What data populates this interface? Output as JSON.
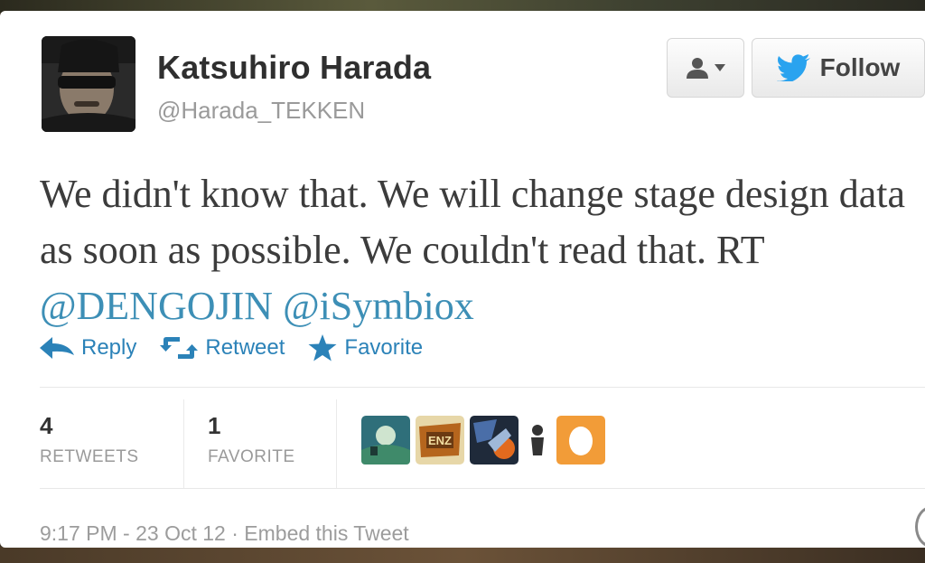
{
  "user": {
    "name": "Katsuhiro Harada",
    "handle": "@Harada_TEKKEN"
  },
  "buttons": {
    "follow_label": "Follow"
  },
  "tweet": {
    "text": "We didn't know that. We will change stage design data as soon as possible. We couldn't read that. RT ",
    "mention1": "@DENGOJIN",
    "mention2": "@iSymbiox"
  },
  "actions": {
    "reply": "Reply",
    "retweet": "Retweet",
    "favorite": "Favorite"
  },
  "stats": {
    "retweets_count": "4",
    "retweets_label": "RETWEETS",
    "favorites_count": "1",
    "favorites_label": "FAVORITE"
  },
  "footer": {
    "timestamp": "9:17 PM - 23 Oct 12",
    "separator": " · ",
    "embed": "Embed this Tweet"
  },
  "colors": {
    "link": "#2b82b8",
    "mention": "#3d8fb6",
    "twitter_bird": "#2aa3ef",
    "text": "#3c3c3c"
  },
  "icons": [
    "user-icon",
    "twitter-bird-icon",
    "reply-arrow-icon",
    "retweet-icon",
    "star-icon"
  ]
}
